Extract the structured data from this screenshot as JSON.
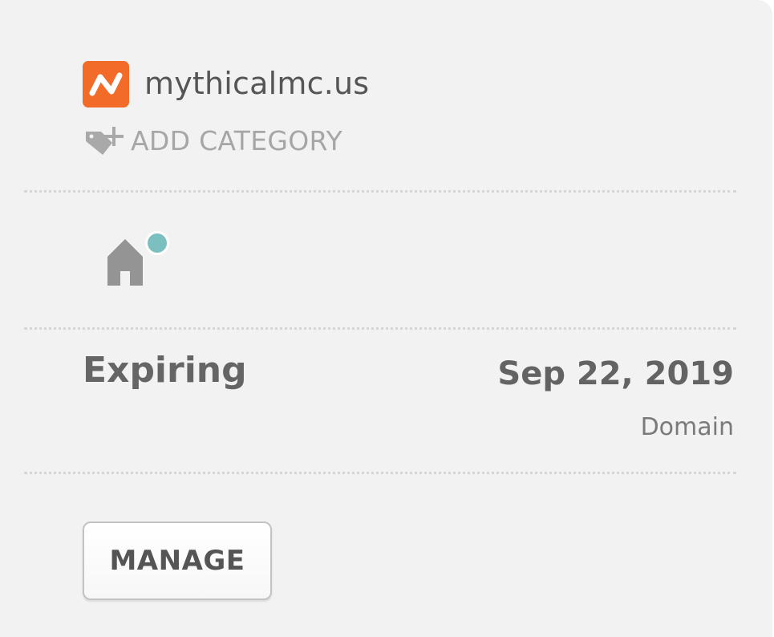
{
  "domain": {
    "name": "mythicalmc.us",
    "logo_icon": "namecheap-logo-icon",
    "logo_color": "#f26b28"
  },
  "category": {
    "add_label": "ADD CATEGORY",
    "icon": "tag-plus-icon"
  },
  "host": {
    "icon": "home-icon",
    "indicator_color": "#7bbfc0"
  },
  "expiry": {
    "status": "Expiring",
    "date": "Sep 22, 2019",
    "type": "Domain"
  },
  "actions": {
    "manage_label": "MANAGE"
  }
}
